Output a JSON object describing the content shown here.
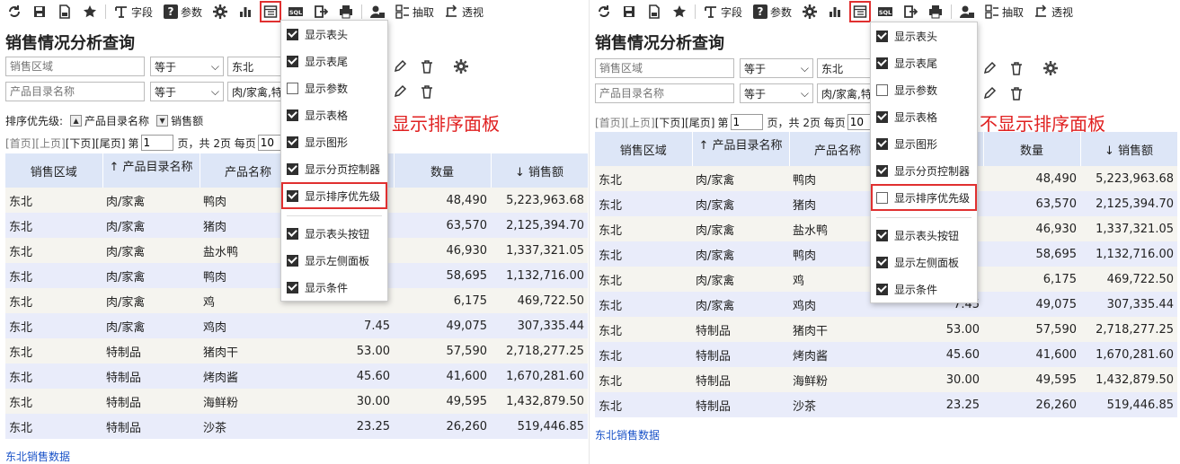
{
  "toolbar": {
    "field_label": "字段",
    "param_label": "参数",
    "sql_label": "SQL",
    "extract_label": "抽取",
    "pivot_label": "透视"
  },
  "page_title": "销售情况分析查询",
  "conditions": [
    {
      "field_placeholder": "销售区域",
      "operator": "等于",
      "value": "东北"
    },
    {
      "field_placeholder": "产品目录名称",
      "operator": "等于",
      "value": "肉/家禽,特"
    }
  ],
  "sort_bar": {
    "label": "排序优先级:",
    "items": [
      "产品目录名称",
      "销售额"
    ]
  },
  "pager": {
    "first": "[首页]",
    "prev": "[上页]",
    "next": "[下页]",
    "last": "[尾页]",
    "page_prefix": "第",
    "page_value": "1",
    "total_text": "页，共 2页 每页",
    "page_size": "10"
  },
  "table": {
    "headers": [
      "销售区域",
      "产品目录名称",
      "产品名称",
      "",
      "数量",
      "销售额"
    ],
    "rows": [
      [
        "东北",
        "肉/家禽",
        "鸭肉",
        "",
        "48,490",
        "5,223,963.68"
      ],
      [
        "东北",
        "肉/家禽",
        "猪肉",
        "",
        "63,570",
        "2,125,394.70"
      ],
      [
        "东北",
        "肉/家禽",
        "盐水鸭",
        "",
        "46,930",
        "1,337,321.05"
      ],
      [
        "东北",
        "肉/家禽",
        "鸭肉",
        "",
        "58,695",
        "1,132,716.00"
      ],
      [
        "东北",
        "肉/家禽",
        "鸡",
        "",
        "6,175",
        "469,722.50"
      ],
      [
        "东北",
        "肉/家禽",
        "鸡肉",
        "7.45",
        "49,075",
        "307,335.44"
      ],
      [
        "东北",
        "特制品",
        "猪肉干",
        "53.00",
        "57,590",
        "2,718,277.25"
      ],
      [
        "东北",
        "特制品",
        "烤肉酱",
        "45.60",
        "41,600",
        "1,670,281.60"
      ],
      [
        "东北",
        "特制品",
        "海鲜粉",
        "30.00",
        "49,595",
        "1,432,879.50"
      ],
      [
        "东北",
        "特制品",
        "沙茶",
        "23.25",
        "26,260",
        "519,446.85"
      ]
    ]
  },
  "footer_link": "东北销售数据",
  "menu_left": [
    {
      "label": "显示表头",
      "checked": true
    },
    {
      "label": "显示表尾",
      "checked": true
    },
    {
      "label": "显示参数",
      "checked": false
    },
    {
      "label": "显示表格",
      "checked": true
    },
    {
      "label": "显示图形",
      "checked": true
    },
    {
      "label": "显示分页控制器",
      "checked": true
    },
    {
      "label": "显示排序优先级",
      "checked": true
    },
    {
      "label": "显示表头按钮",
      "checked": true
    },
    {
      "label": "显示左侧面板",
      "checked": true
    },
    {
      "label": "显示条件",
      "checked": true
    }
  ],
  "menu_right": [
    {
      "label": "显示表头",
      "checked": true
    },
    {
      "label": "显示表尾",
      "checked": true
    },
    {
      "label": "显示参数",
      "checked": false
    },
    {
      "label": "显示表格",
      "checked": true
    },
    {
      "label": "显示图形",
      "checked": true
    },
    {
      "label": "显示分页控制器",
      "checked": true
    },
    {
      "label": "显示排序优先级",
      "checked": false
    },
    {
      "label": "显示表头按钮",
      "checked": true
    },
    {
      "label": "显示左侧面板",
      "checked": true
    },
    {
      "label": "显示条件",
      "checked": true
    }
  ],
  "annotations": {
    "left": "显示排序面板",
    "right": "不显示排序面板"
  },
  "colors": {
    "header_bg": "#dde6f7",
    "row_odd": "#f5f4ef",
    "row_even": "#e9ecfa",
    "highlight": "#e03030",
    "link": "#1a53c8"
  },
  "icons": [
    "refresh-icon",
    "save-icon",
    "save-as-icon",
    "star-icon",
    "field-icon",
    "param-icon",
    "gear-icon",
    "chart-icon",
    "layout-icon",
    "sql-icon",
    "export-icon",
    "print-icon",
    "user-icon",
    "extract-icon",
    "pivot-icon",
    "edit-icon",
    "trash-icon"
  ]
}
